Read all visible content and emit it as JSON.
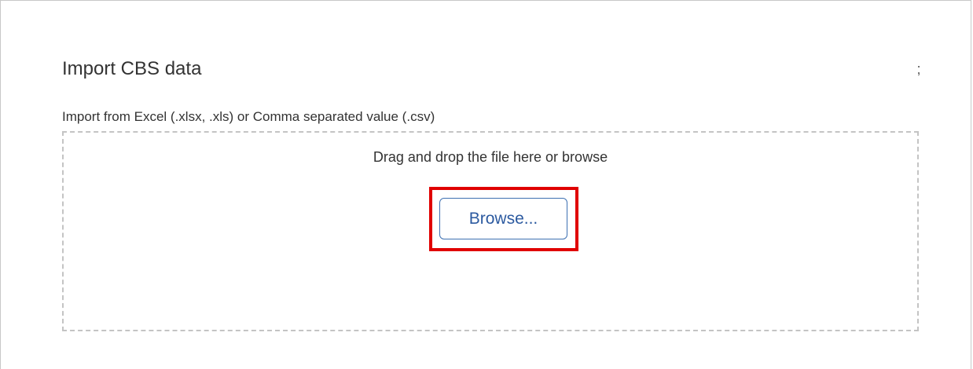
{
  "dialog": {
    "title": "Import CBS data",
    "menu_glyph": ";",
    "subtitle": "Import from Excel (.xlsx, .xls) or Comma separated value (.csv)"
  },
  "dropzone": {
    "instruction": "Drag and drop the file here or browse",
    "browse_label": "Browse...",
    "highlight_color": "#e00000",
    "button_color": "#2c5aa0"
  }
}
